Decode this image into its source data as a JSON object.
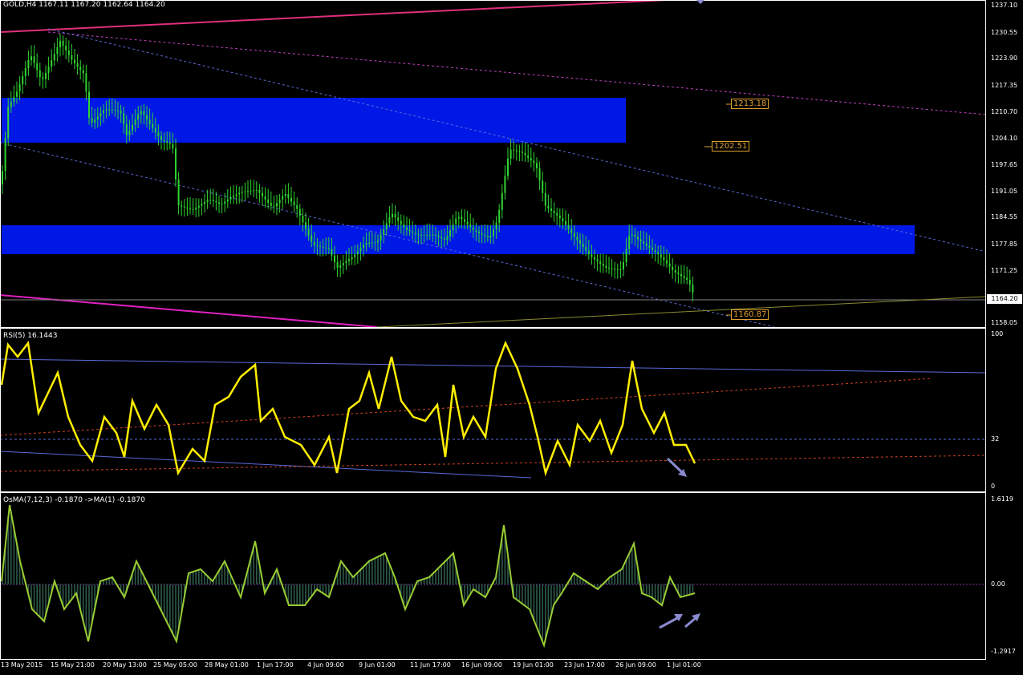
{
  "symbol_header": "GOLD,H4  1167.11 1167.20 1162.64 1164.20",
  "rsi_header": "RSI(5) 16.1443",
  "osma_header": "OsMA(7,12,3) -0.1870  ->MA(1) -0.1870",
  "price_axis": [
    "1237.10",
    "1230.55",
    "1223.90",
    "1217.35",
    "1210.70",
    "1204.10",
    "1197.65",
    "1191.05",
    "1184.55",
    "1177.85",
    "1171.25",
    "1158.05"
  ],
  "current_price": "1164.20",
  "levels": [
    "1213.18",
    "1202.51",
    "1160.87"
  ],
  "rsi_axis": [
    "100",
    "32",
    "0"
  ],
  "osma_axis": [
    "1.6119",
    "0.00",
    "-1.2917"
  ],
  "time_axis": [
    "13 May 2015",
    "15 May 21:00",
    "20 May 13:00",
    "25 May 05:00",
    "28 May 01:00",
    "1 Jun 17:00",
    "4 Jun 09:00",
    "9 Jun 01:00",
    "11 Jun 17:00",
    "16 Jun 09:00",
    "19 Jun 01:00",
    "23 Jun 17:00",
    "26 Jun 09:00",
    "1 Jul 01:00"
  ],
  "colors": {
    "zones": "#0018e6",
    "candles": "#2fd52f",
    "rsi": "#ffee00",
    "osma_line": "#9acd32",
    "osma_hist": "#2f5a4a",
    "upper_line": "#e0307a",
    "trend_dash": "#5a6ad8",
    "levels": "#e0a030"
  },
  "icons": [
    "arrow-down-icon",
    "arrow-up-icon"
  ]
}
